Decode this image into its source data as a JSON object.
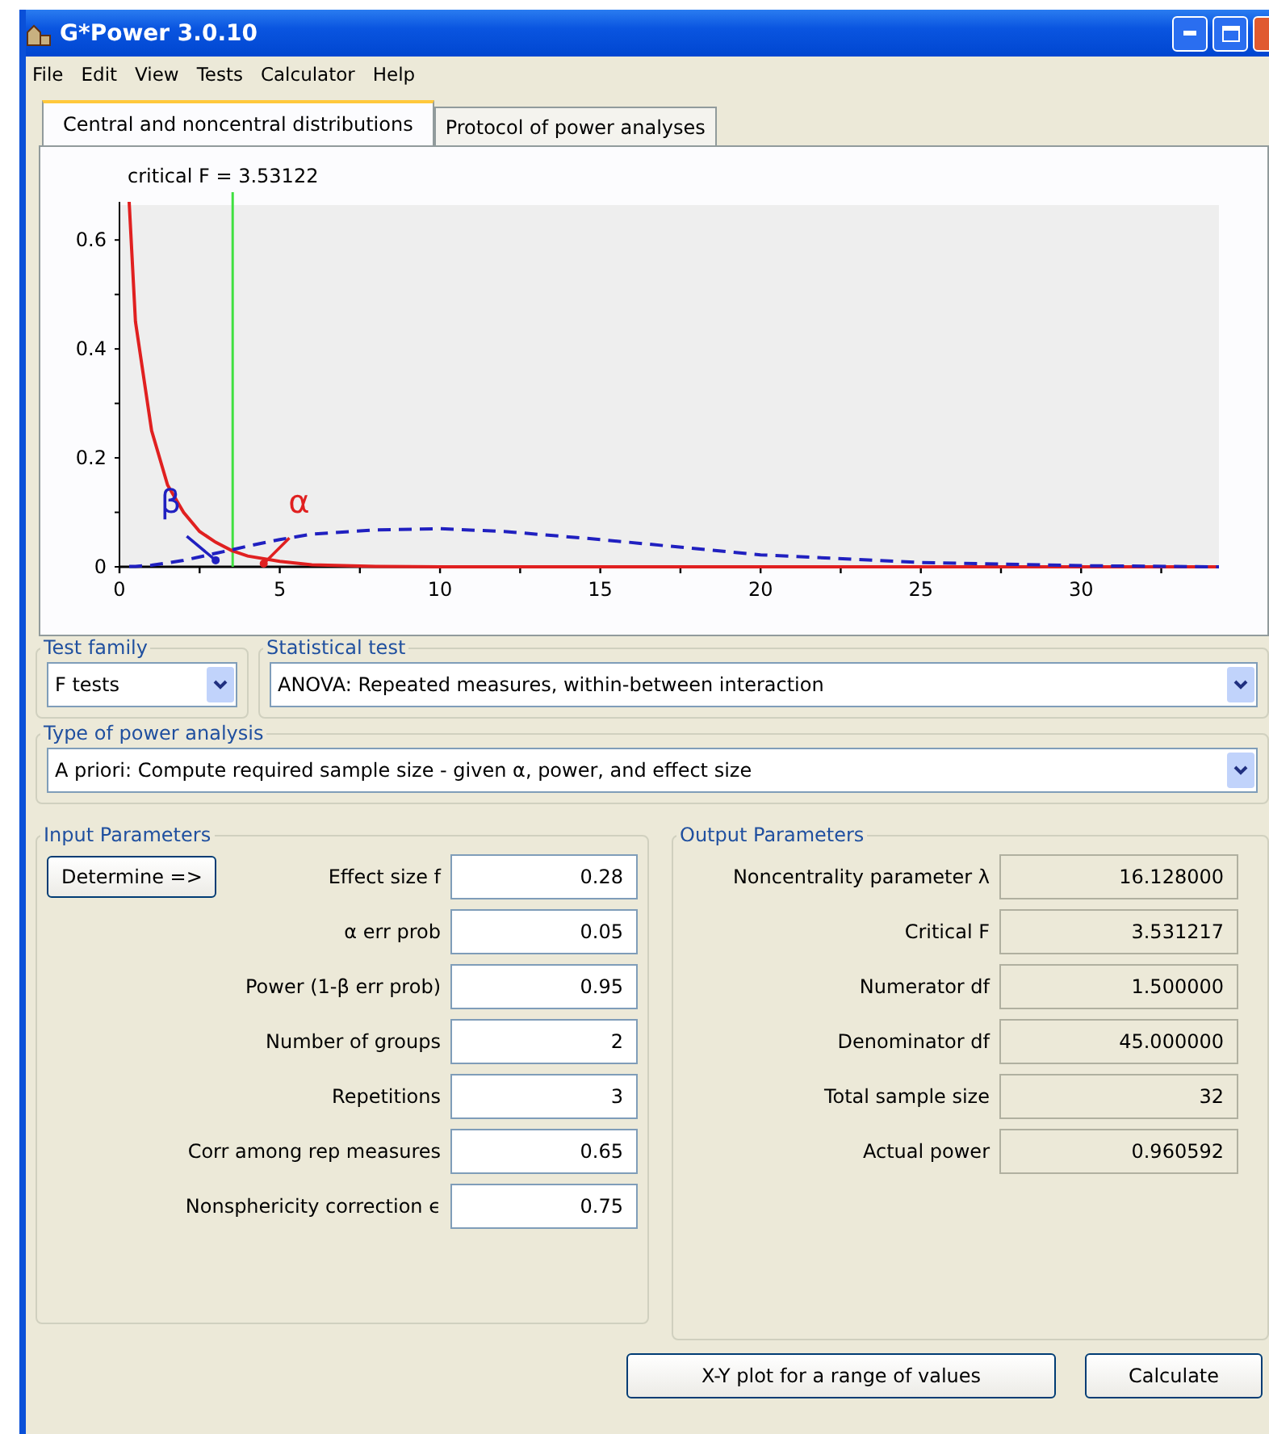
{
  "window": {
    "title": "G*Power 3.0.10"
  },
  "menu": [
    "File",
    "Edit",
    "View",
    "Tests",
    "Calculator",
    "Help"
  ],
  "tabs": [
    {
      "label": "Central and noncentral distributions",
      "selected": true
    },
    {
      "label": "Protocol of power analyses",
      "selected": false
    }
  ],
  "chart_data": {
    "type": "line",
    "xlim": [
      0,
      34.3
    ],
    "ylim": [
      0,
      0.67
    ],
    "xticks": [
      0,
      5,
      10,
      15,
      20,
      25,
      30
    ],
    "yticks": [
      0,
      0.2,
      0.4,
      0.6
    ],
    "x": [
      0.3,
      0.5,
      1,
      1.5,
      2,
      2.5,
      3,
      3.5,
      4,
      5,
      6,
      8,
      10,
      12,
      15,
      20,
      25,
      30,
      34.3
    ],
    "series": [
      {
        "color": "#e02020",
        "values": [
          0.67,
          0.45,
          0.25,
          0.15,
          0.1,
          0.065,
          0.045,
          0.03,
          0.02,
          0.01,
          0.004,
          0.001,
          0,
          0,
          0,
          0,
          0,
          0,
          0
        ]
      },
      {
        "color": "#2020c0",
        "line_style": "dashed",
        "values": [
          0.001,
          0.001,
          0.003,
          0.007,
          0.012,
          0.018,
          0.025,
          0.031,
          0.038,
          0.05,
          0.06,
          0.068,
          0.07,
          0.065,
          0.05,
          0.022,
          0.008,
          0.002,
          0
        ]
      }
    ],
    "ref_lines": [
      {
        "axis": "x",
        "value": 3.53122,
        "label": "critical F = 3.53122",
        "color": "#40e040"
      }
    ],
    "annotations": [
      "β",
      "α"
    ]
  },
  "test_family": {
    "legend": "Test family",
    "value": "F tests"
  },
  "statistical_test": {
    "legend": "Statistical test",
    "value": "ANOVA: Repeated measures, within-between interaction"
  },
  "power_analysis": {
    "legend": "Type of power analysis",
    "value": "A priori: Compute required sample size - given α, power, and effect size"
  },
  "input": {
    "legend": "Input Parameters",
    "determine": "Determine =>",
    "rows": [
      {
        "label": "Effect size f",
        "value": "0.28"
      },
      {
        "label": "α err prob",
        "value": "0.05"
      },
      {
        "label": "Power (1-β err prob)",
        "value": "0.95"
      },
      {
        "label": "Number of groups",
        "value": "2"
      },
      {
        "label": "Repetitions",
        "value": "3"
      },
      {
        "label": "Corr among rep measures",
        "value": "0.65"
      },
      {
        "label": "Nonsphericity correction ϵ",
        "value": "0.75"
      }
    ]
  },
  "output": {
    "legend": "Output Parameters",
    "rows": [
      {
        "label": "Noncentrality parameter λ",
        "value": "16.128000"
      },
      {
        "label": "Critical F",
        "value": "3.531217"
      },
      {
        "label": "Numerator df",
        "value": "1.500000"
      },
      {
        "label": "Denominator df",
        "value": "45.000000"
      },
      {
        "label": "Total sample size",
        "value": "32"
      },
      {
        "label": "Actual power",
        "value": "0.960592"
      }
    ]
  },
  "buttons": [
    "X-Y plot for a range of values",
    "Calculate"
  ]
}
